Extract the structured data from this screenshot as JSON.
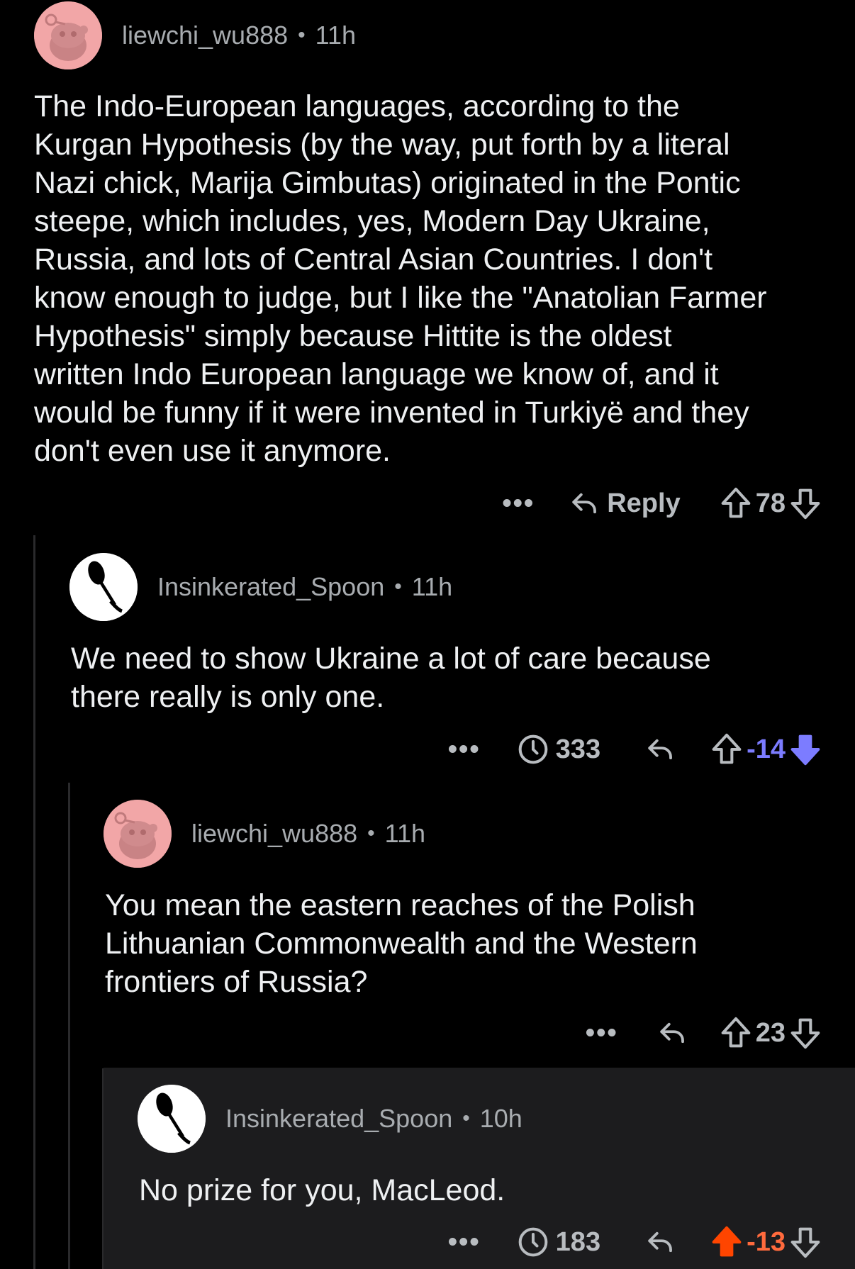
{
  "comments": [
    {
      "username": "liewchi_wu888",
      "time": "11h",
      "body": "The Indo-European languages, according to the\nKurgan Hypothesis (by the way, put forth by a literal\nNazi chick, Marija Gimbutas) originated in the Pontic\nsteepe, which includes, yes, Modern Day Ukraine,\nRussia, and lots of Central Asian Countries. I don't\nknow enough to judge, but I like the \"Anatolian Farmer\nHypothesis\" simply because Hittite is the oldest\nwritten Indo European language we know of, and it\nwould be funny if it were invented in Turkiyë and they\ndon't even use it anymore.",
      "reply_label": "Reply",
      "score": "78"
    },
    {
      "username": "Insinkerated_Spoon",
      "time": "11h",
      "body": "We need to show Ukraine a lot of care because\nthere  really is only one.",
      "timer_count": "333",
      "score": "-14"
    },
    {
      "username": "liewchi_wu888",
      "time": "11h",
      "body": "You mean the eastern reaches of the Polish\nLithuanian Commonwealth and the Western\nfrontiers of Russia?",
      "score": "23"
    },
    {
      "username": "Insinkerated_Spoon",
      "time": "10h",
      "body": "No prize for you, MacLeod.",
      "timer_count": "183",
      "score": "-13"
    }
  ],
  "meta_separator": "•",
  "more_label": "•••",
  "colors": {
    "background": "#000000",
    "highlight_bg": "#1c1c1e",
    "downvote": "#7c7cff",
    "upvote": "#ff6a3d",
    "avatar_pink": "#f2a6a7"
  },
  "icons": [
    "more-icon",
    "reply-icon",
    "upvote-icon",
    "downvote-icon",
    "timer-icon",
    "snoo-avatar-icon",
    "spoon-avatar-icon"
  ]
}
